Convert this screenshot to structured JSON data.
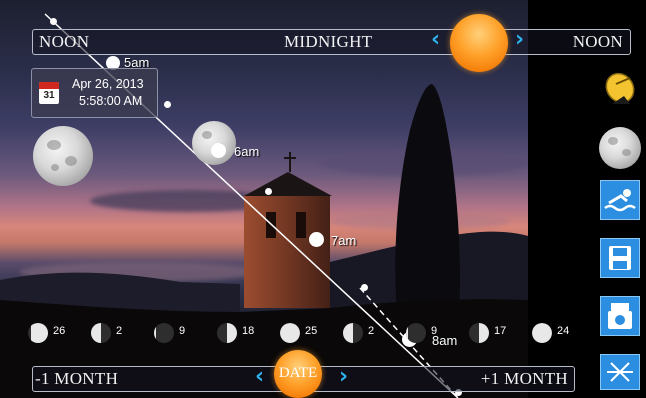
{
  "time_bar": {
    "left_label": "NOON",
    "center_label": "MIDNIGHT",
    "right_label": "NOON",
    "left_arrow": "‹",
    "right_arrow": "›"
  },
  "date_bar": {
    "left_label": "-1 MONTH",
    "center_label": "DATE",
    "right_label": "+1 MONTH",
    "left_arrow": "‹",
    "right_arrow": "›"
  },
  "date_info": {
    "calendar_day": "31",
    "date": "Apr 26, 2013",
    "time": "5:58:00 AM"
  },
  "moon_path_labels": [
    "5am",
    "6am",
    "7am",
    "8am"
  ],
  "moon_phases": [
    {
      "day": "26",
      "lit": 0.85,
      "side": "right"
    },
    {
      "day": "2",
      "lit": 0.5,
      "side": "left"
    },
    {
      "day": "9",
      "lit": 0.1,
      "side": "left"
    },
    {
      "day": "18",
      "lit": 0.5,
      "side": "right"
    },
    {
      "day": "25",
      "lit": 1.0,
      "side": "right"
    },
    {
      "day": "2",
      "lit": 0.5,
      "side": "left"
    },
    {
      "day": "9",
      "lit": 0.1,
      "side": "left"
    },
    {
      "day": "17",
      "lit": 0.5,
      "side": "right"
    },
    {
      "day": "24",
      "lit": 1.0,
      "side": "right"
    }
  ],
  "side_toolbar": [
    {
      "name": "satellite-dish-icon"
    },
    {
      "name": "moon-view-icon"
    },
    {
      "name": "swimmer-icon"
    },
    {
      "name": "save-icon"
    },
    {
      "name": "camera-icon"
    },
    {
      "name": "snowflake-icon"
    }
  ],
  "colors": {
    "accent_blue": "#2fb3ee",
    "orb_orange": "#f58a10",
    "toolbar_blue": "#2b8ee0"
  }
}
